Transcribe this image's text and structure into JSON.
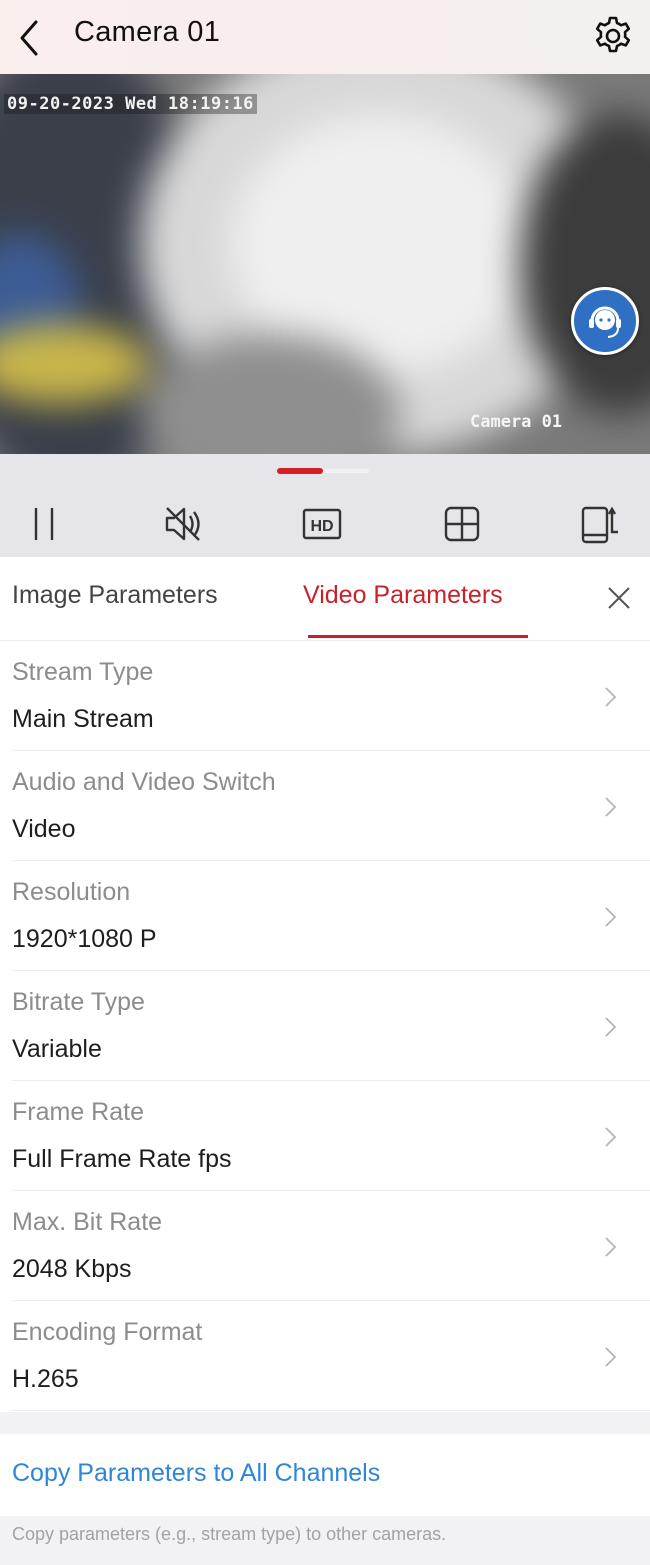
{
  "header": {
    "title": "Camera 01",
    "back_icon": "chevron-left-icon",
    "settings_icon": "gear-icon"
  },
  "video": {
    "osd_timestamp": "09-20-2023 Wed 18:19:16",
    "osd_camera_name": "Camera 01",
    "support_icon": "headset-support-icon"
  },
  "controls": {
    "page_indicator": {
      "count": 2,
      "active_index": 0
    },
    "buttons": [
      {
        "name": "pause",
        "icon": "pause-icon"
      },
      {
        "name": "mute",
        "icon": "speaker-muted-icon"
      },
      {
        "name": "quality",
        "icon": "hd-icon",
        "label": "HD"
      },
      {
        "name": "layout",
        "icon": "grid-icon"
      },
      {
        "name": "rotate",
        "icon": "phone-rotate-icon"
      }
    ]
  },
  "tabs": {
    "items": [
      "Image Parameters",
      "Video Parameters"
    ],
    "active": "Video Parameters",
    "close_icon": "close-icon"
  },
  "parameters": [
    {
      "label": "Stream Type",
      "value": "Main Stream"
    },
    {
      "label": "Audio and Video Switch",
      "value": "Video"
    },
    {
      "label": "Resolution",
      "value": "1920*1080 P"
    },
    {
      "label": "Bitrate Type",
      "value": "Variable"
    },
    {
      "label": "Frame Rate",
      "value": "Full Frame Rate fps"
    },
    {
      "label": "Max. Bit Rate",
      "value": "2048 Kbps"
    },
    {
      "label": "Encoding Format",
      "value": "H.265"
    }
  ],
  "copy": {
    "link": "Copy Parameters to All Channels",
    "hint": "Copy parameters (e.g., stream type) to other cameras."
  },
  "colors": {
    "accent_red": "#c8212a",
    "link_blue": "#2e86d8",
    "support_blue": "#2f6fc4"
  }
}
